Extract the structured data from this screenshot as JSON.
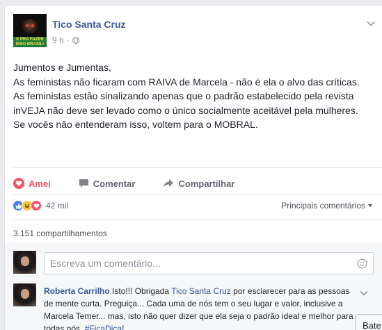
{
  "post": {
    "author": "Tico Santa Cruz",
    "time": "9 h",
    "separator": "·",
    "avatar_banner": "E PRA FAZER ISSO BRASIL!",
    "text_lines": [
      "Jumentos e Jumentas,",
      "As feministas não ficaram com RAIVA de Marcela - não é ela o alvo das críticas.",
      "As feministas estão sinalizando apenas que o padrão estabelecido pela revista inVEJA não deve ser levado como o único socialmente aceitável pela mulheres.",
      "Se vocês não entenderam isso, voltem para o MOBRAL."
    ]
  },
  "actions": {
    "love": "Amei",
    "comment": "Comentar",
    "share": "Compartilhar"
  },
  "reactions": {
    "count": "42 mil",
    "sort_label": "Principais comentários",
    "icons": [
      "like-icon",
      "haha-icon",
      "love-icon"
    ]
  },
  "shares": "3.151 compartilhamentos",
  "comment_input": {
    "placeholder": "Escreva um comentário..."
  },
  "top_comment": {
    "author": "Roberta Carrilho",
    "text_1": " Isto!!! Obrigada ",
    "mention": "Tico Santa Cruz",
    "text_2": " por esclarecer para as pessoas de mente curta. Preguiça... Cada uma de nós tem o seu lugar e valor, inclusive a Marcela Temer... mas, isto não quer dizer que ela seja o padrão ideal e melhor para todas nós. ",
    "hashtag": "#FicaDica",
    "text_3": "!"
  },
  "chat_tab": {
    "label": "Bate"
  },
  "colors": {
    "link": "#365899",
    "love": "#f25268",
    "like": "#4f7ff3",
    "haha": "#f7c63c",
    "muted": "#90949c",
    "background": "#e9ebee"
  }
}
